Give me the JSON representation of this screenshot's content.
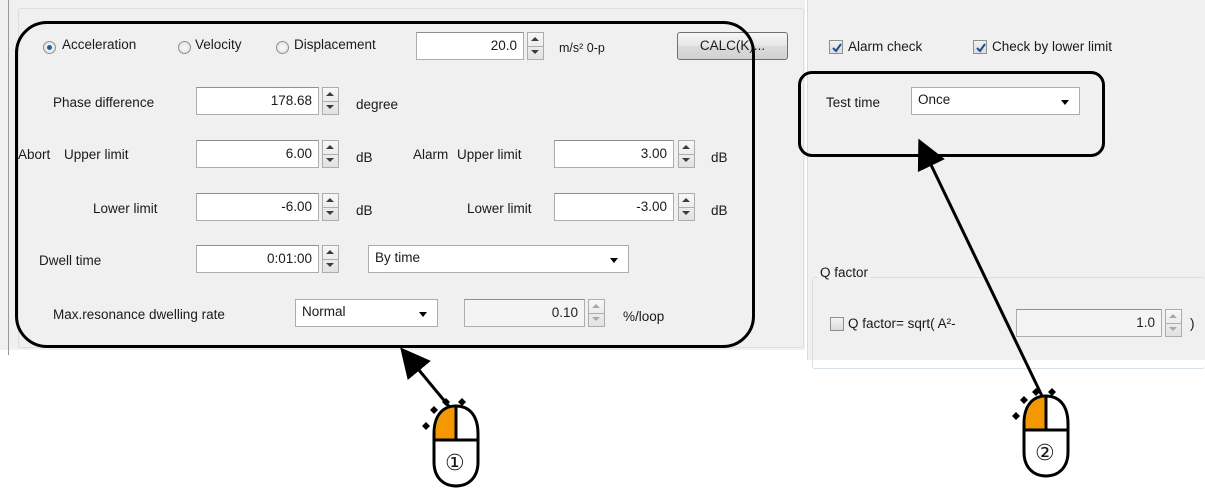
{
  "left_panel": {
    "radio_acceleration": "Acceleration",
    "radio_velocity": "Velocity",
    "radio_displacement": "Displacement",
    "amplitude_value": "20.0",
    "amplitude_unit": "m/s² 0-p",
    "calc_button": "CALC(K)...",
    "phase_label": "Phase difference",
    "phase_value": "178.68",
    "phase_unit": "degree",
    "abort_label": "Abort",
    "abort_upper_label": "Upper limit",
    "abort_upper_value": "6.00",
    "abort_upper_unit": "dB",
    "alarm_label": "Alarm",
    "alarm_upper_label": "Upper limit",
    "alarm_upper_value": "3.00",
    "alarm_upper_unit": "dB",
    "abort_lower_label": "Lower limit",
    "abort_lower_value": "-6.00",
    "abort_lower_unit": "dB",
    "alarm_lower_label": "Lower limit",
    "alarm_lower_value": "-3.00",
    "alarm_lower_unit": "dB",
    "dwell_label": "Dwell time",
    "dwell_value": "0:01:00",
    "dwell_mode": "By time",
    "max_rate_label": "Max.resonance dwelling rate",
    "max_rate_mode": "Normal",
    "max_rate_value": "0.10",
    "max_rate_unit": "%/loop"
  },
  "right_panel": {
    "alarm_check_label": "Alarm check",
    "lower_limit_check_label": "Check by lower limit",
    "test_time_label": "Test time",
    "test_time_value": "Once",
    "q_group_title": "Q factor",
    "q_check_label": "Q factor= sqrt( A²-",
    "q_value": "1.0",
    "q_close_paren": ")"
  },
  "callouts": {
    "one": "①",
    "two": "②"
  },
  "colors": {
    "panel_bg": "#f0f0f0",
    "callout_border": "#000000",
    "mouse_accent": "#f39800",
    "radio_dot": "#1e5fa8"
  }
}
